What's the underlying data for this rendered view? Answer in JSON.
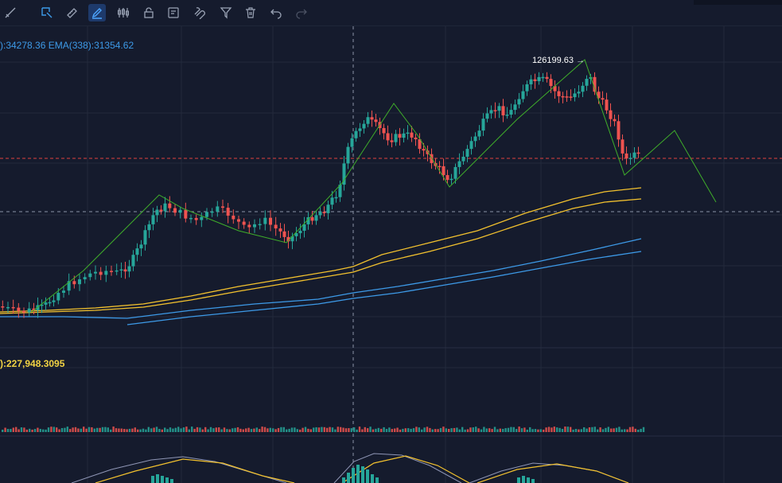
{
  "toolbar": {
    "items": [
      {
        "name": "crosshair-icon"
      },
      {
        "name": "select-icon"
      },
      {
        "name": "ruler-icon"
      },
      {
        "name": "pen-draw-icon",
        "active": true
      },
      {
        "name": "candle-pattern-icon"
      },
      {
        "name": "lock-icon"
      },
      {
        "name": "edit-list-icon"
      },
      {
        "name": "magnet-icon"
      },
      {
        "name": "filter-icon"
      },
      {
        "name": "trash-icon"
      },
      {
        "name": "undo-icon"
      },
      {
        "name": "redo-icon"
      }
    ]
  },
  "indicators": {
    "ema_text": "):34278.36  EMA(338):31354.62",
    "volume_text": "):227,948.3095"
  },
  "chart_data": {
    "type": "candlestick",
    "peak_label": "126199.63",
    "colors": {
      "up": "#26a69a",
      "down": "#ef5350",
      "zigzag": "#3fae2a",
      "ema_yellow": "#f2c12e",
      "ema_blue": "#3d9ae8",
      "grid": "#222a3c",
      "crosshair": "#8a93a6",
      "price_line": "#e04040"
    }
  }
}
